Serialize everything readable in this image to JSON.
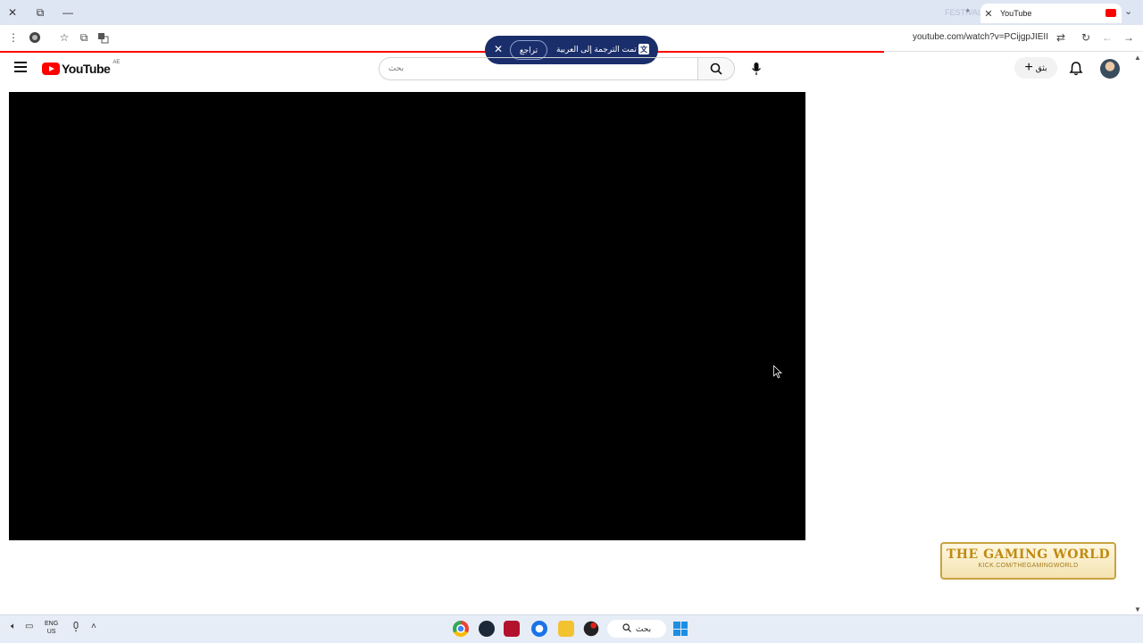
{
  "browser": {
    "tab_title": "YouTube",
    "ghost_tab_text": "FESTIVAL",
    "url": "youtube.com/watch?v=PCijgpJIEII"
  },
  "translate_popup": {
    "message": "تمت الترجمة إلى العربية",
    "review_label": "تراجع"
  },
  "youtube": {
    "logo_text": "YouTube",
    "country_code": "AE",
    "search_placeholder": "بحث",
    "create_label": "بثق"
  },
  "watermark": {
    "title": "THE GAMING WORLD",
    "subtitle": "KICK.COM/THEGAMINGWORLD"
  },
  "taskbar": {
    "lang_line1": "ENG",
    "lang_line2": "US",
    "search_label": "بحث"
  },
  "colors": {
    "youtube_red": "#ff0000",
    "translate_bg": "#1a2e6b",
    "taskbar_bg": "#e7edf6",
    "watermark_gold": "#c08a12"
  },
  "icons": [
    "close-icon",
    "restore-icon",
    "minimize-icon",
    "menu-dots-icon",
    "extension-icon",
    "star-icon",
    "translate-icon",
    "reload-icon",
    "back-arrow-icon",
    "forward-arrow-icon",
    "hamburger-icon",
    "search-icon",
    "mic-icon",
    "plus-icon",
    "bell-icon",
    "windows-start-icon"
  ]
}
